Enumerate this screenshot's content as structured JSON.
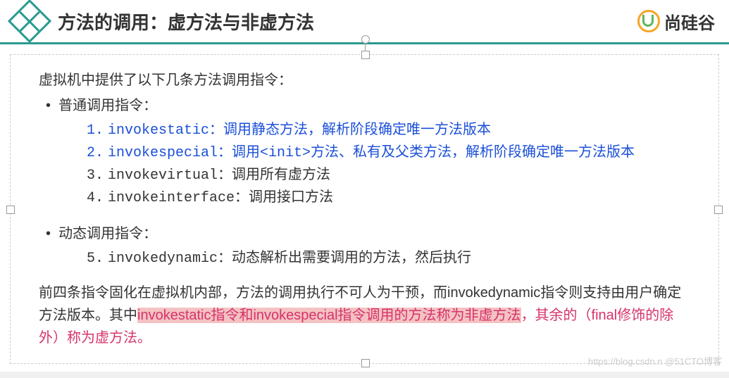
{
  "title": "方法的调用：虚方法与非虚方法",
  "brand": "尚硅谷",
  "intro": "虚拟机中提供了以下几条方法调用指令：",
  "section1": {
    "heading": "普通调用指令：",
    "items": [
      {
        "num": "1.",
        "code": "invokestatic：",
        "desc": "调用静态方法，解析阶段确定唯一方法版本"
      },
      {
        "num": "2.",
        "code": "invokespecial：",
        "desc": "调用<init>方法、私有及父类方法，解析阶段确定唯一方法版本"
      },
      {
        "num": "3.",
        "code": "invokevirtual：",
        "desc": "调用所有虚方法"
      },
      {
        "num": "4.",
        "code": "invokeinterface：",
        "desc": "调用接口方法"
      }
    ]
  },
  "section2": {
    "heading": "动态调用指令：",
    "items": [
      {
        "num": "5.",
        "code": "invokedynamic：",
        "desc": "动态解析出需要调用的方法，然后执行"
      }
    ]
  },
  "footer": {
    "p1": "前四条指令固化在虚拟机内部，方法的调用执行不可人为干预，而invokedynamic指令则支持由用户确定方法版本。其中",
    "hl": "invokestatic指令和invokespecial指令调用的方法称为非虚方法",
    "p2": "，其余的（final修饰的除外）称为虚方法。"
  },
  "watermark": "https://blog.csdn.n @51CTO博客"
}
